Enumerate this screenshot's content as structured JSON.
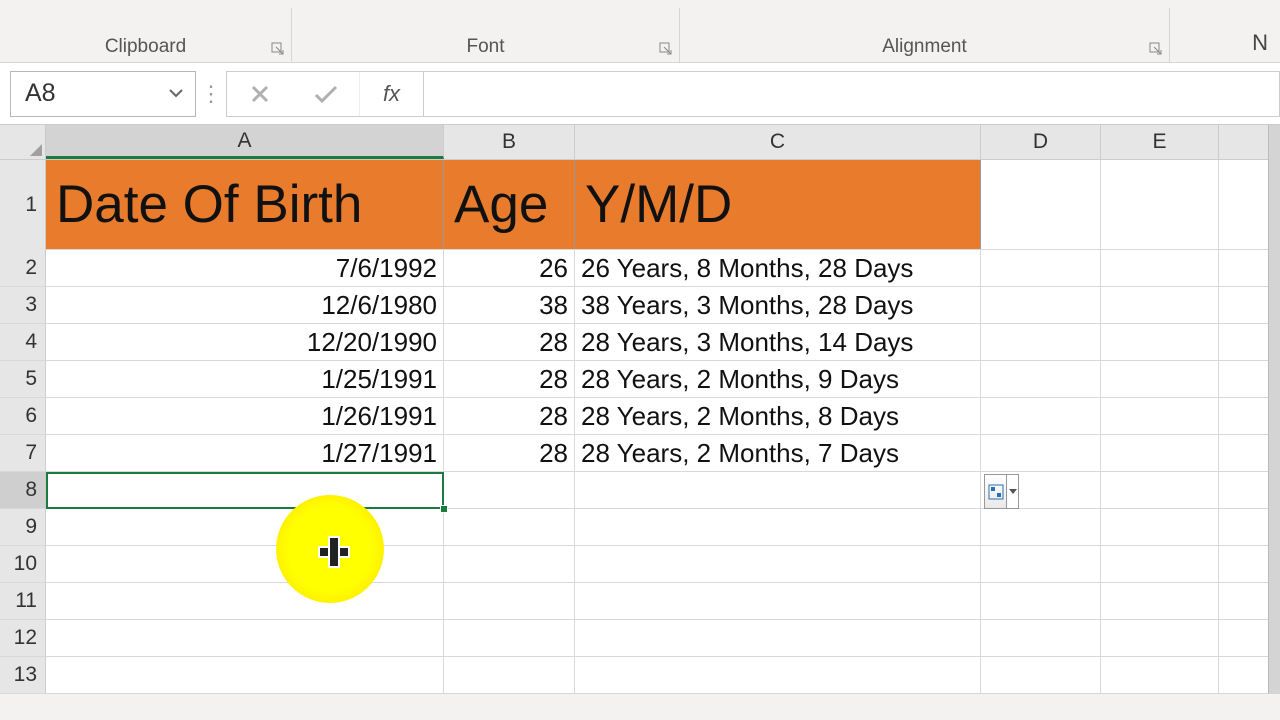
{
  "ribbon": {
    "groups": {
      "clipboard": "Clipboard",
      "font": "Font",
      "alignment": "Alignment",
      "number_hint": "N"
    }
  },
  "formula_bar": {
    "name_box": "A8",
    "cancel": "✕",
    "enter": "✓",
    "fx": "fx",
    "formula": ""
  },
  "columns": [
    "A",
    "B",
    "C",
    "D",
    "E"
  ],
  "headers": {
    "A": "Date Of Birth",
    "B": "Age",
    "C": "Y/M/D"
  },
  "rows": [
    {
      "n": 2,
      "A": "7/6/1992",
      "B": "26",
      "C": "26 Years, 8 Months, 28 Days"
    },
    {
      "n": 3,
      "A": "12/6/1980",
      "B": "38",
      "C": "38 Years, 3 Months, 28 Days"
    },
    {
      "n": 4,
      "A": "12/20/1990",
      "B": "28",
      "C": "28 Years, 3 Months, 14 Days"
    },
    {
      "n": 5,
      "A": "1/25/1991",
      "B": "28",
      "C": "28 Years, 2 Months, 9 Days"
    },
    {
      "n": 6,
      "A": "1/26/1991",
      "B": "28",
      "C": "28 Years, 2 Months, 8 Days"
    },
    {
      "n": 7,
      "A": "1/27/1991",
      "B": "28",
      "C": "28 Years, 2 Months, 7 Days"
    }
  ],
  "empty_row_labels": [
    "8",
    "9",
    "10",
    "11",
    "12",
    "13"
  ],
  "active_cell": "A8",
  "colors": {
    "header_fill": "#e87b2c",
    "selection": "#1a7a3f"
  }
}
